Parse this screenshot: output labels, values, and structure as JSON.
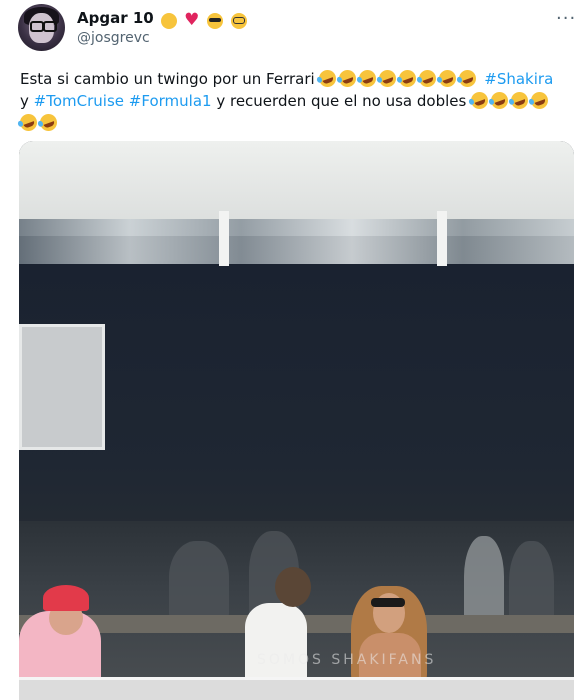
{
  "tweet": {
    "author_name": "Apgar 10",
    "author_emojis": [
      "relieved-face",
      "two-hearts",
      "sunglasses-face",
      "nerd-face"
    ],
    "handle": "@josgrevc",
    "more_label": "···",
    "text_part1": "Esta si cambio un twingo por un Ferrari",
    "hashtag_shakira": "#Shakira",
    "text_part2": "y",
    "hashtag_tomcruise": "#TomCruise",
    "hashtag_formula1": "#Formula1",
    "text_part3": "y recuerden que el no usa dobles",
    "emoji_rofl": "rolling-on-floor-laughing"
  },
  "media": {
    "watermark": "SOMOS SHAKIFANS"
  },
  "colors": {
    "link": "#1d9bf0",
    "secondary_text": "#536471"
  }
}
